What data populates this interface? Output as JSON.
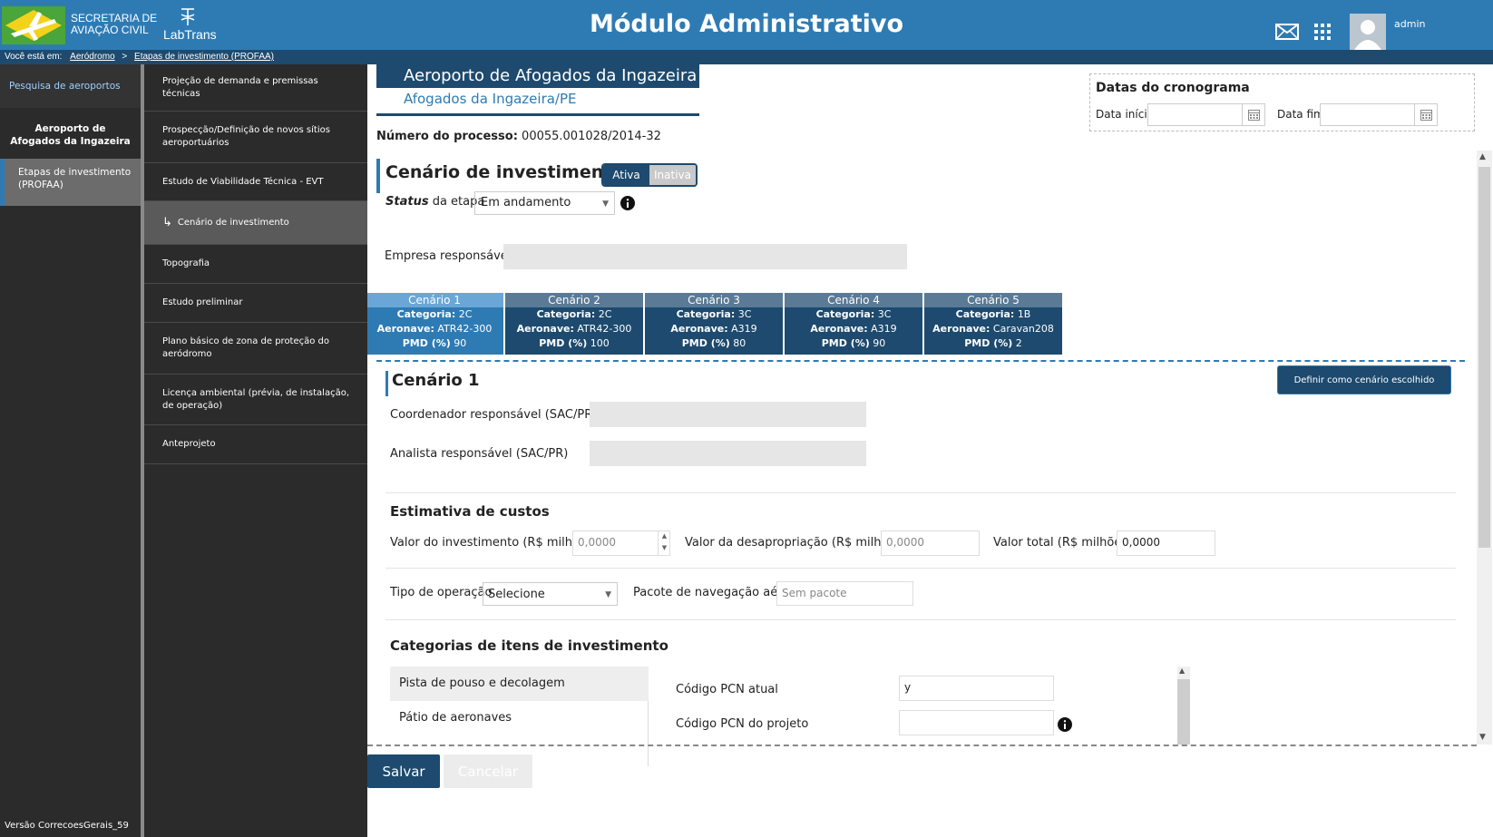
{
  "header": {
    "logo_sac_line1": "SECRETARIA DE",
    "logo_sac_line2": "AVIAÇÃO CIVIL",
    "logo_labtrans": "LabTrans",
    "title": "Módulo Administrativo",
    "username": "admin"
  },
  "breadcrumb": {
    "prefix": "Você está em:",
    "item1": "Aeródromo",
    "separator": ">",
    "item2": "Etapas de investimento (PROFAA)"
  },
  "sidebar": {
    "search": "Pesquisa de aeroportos",
    "airport": "Aeroporto de Afogados da Ingazeira",
    "profaa": "Etapas de investimento (PROFAA)",
    "version": "Versão CorrecoesGerais_59"
  },
  "steps": [
    "Projeção de demanda e premissas técnicas",
    "Prospecção/Definição de novos sítios aeroportuários",
    "Estudo de Viabilidade Técnica - EVT",
    "Cenário de investimento",
    "Topografia",
    "Estudo preliminar",
    "Plano básico de zona de proteção do aeródromo",
    "Licença ambiental (prévia, de instalação, de operação)",
    "Anteprojeto"
  ],
  "airport": {
    "title": "Aeroporto de Afogados da Ingazeira",
    "subtitle": "Afogados da Ingazeira/PE",
    "process_label": "Número do processo:",
    "process_number": "00055.001028/2014-32"
  },
  "schedule": {
    "title": "Datas do cronograma",
    "start_label": "Data início",
    "end_label": "Data fim"
  },
  "scenario_section": {
    "title": "Cenário de investimento",
    "toggle_active": "Ativa",
    "toggle_inactive": "Inativa",
    "status_label_italic": "Status",
    "status_label_rest": "da etapa",
    "status_value": "Em andamento",
    "company_label": "Empresa responsável"
  },
  "scenarios": [
    {
      "name": "Cenário 1",
      "cat_label": "Categoria:",
      "cat": "2C",
      "plane_label": "Aeronave:",
      "plane": "ATR42-300",
      "pmd_label": "PMD (%)",
      "pmd": "90"
    },
    {
      "name": "Cenário 2",
      "cat_label": "Categoria:",
      "cat": "2C",
      "plane_label": "Aeronave:",
      "plane": "ATR42-300",
      "pmd_label": "PMD (%)",
      "pmd": "100"
    },
    {
      "name": "Cenário 3",
      "cat_label": "Categoria:",
      "cat": "3C",
      "plane_label": "Aeronave:",
      "plane": "A319",
      "pmd_label": "PMD (%)",
      "pmd": "80"
    },
    {
      "name": "Cenário 4",
      "cat_label": "Categoria:",
      "cat": "3C",
      "plane_label": "Aeronave:",
      "plane": "A319",
      "pmd_label": "PMD (%)",
      "pmd": "90"
    },
    {
      "name": "Cenário 5",
      "cat_label": "Categoria:",
      "cat": "1B",
      "plane_label": "Aeronave:",
      "plane": "Caravan208",
      "pmd_label": "PMD (%)",
      "pmd": "2"
    }
  ],
  "detail": {
    "title": "Cenário 1",
    "choose_button": "Definir como cenário escolhido",
    "coord_label": "Coordenador responsável (SAC/PR)",
    "analyst_label": "Analista responsável (SAC/PR)",
    "costs_title": "Estimativa de custos",
    "invest_label": "Valor do investimento (R$ milhões)",
    "invest_value": "0,0000",
    "expro_label": "Valor da desapropriação (R$ milhões)",
    "expro_value": "0,0000",
    "total_label": "Valor total (R$ milhões)",
    "total_value": "0,0000",
    "op_type_label": "Tipo de operação",
    "op_type_value": "Selecione",
    "nav_label": "Pacote de navegação aérea",
    "nav_value": "Sem pacote",
    "categories_title": "Categorias de itens de investimento",
    "categories": [
      "Pista de pouso e decolagem",
      "Pátio de aeronaves"
    ],
    "pcn_current_label": "Código PCN atual",
    "pcn_current_value": "y",
    "pcn_project_label": "Código PCN do projeto"
  },
  "actions": {
    "save": "Salvar",
    "cancel": "Cancelar"
  },
  "colors": {
    "header_blue": "#2e7bb4",
    "dark_navy": "#1d4a6e",
    "sidebar_dark": "#2b2b2b"
  }
}
